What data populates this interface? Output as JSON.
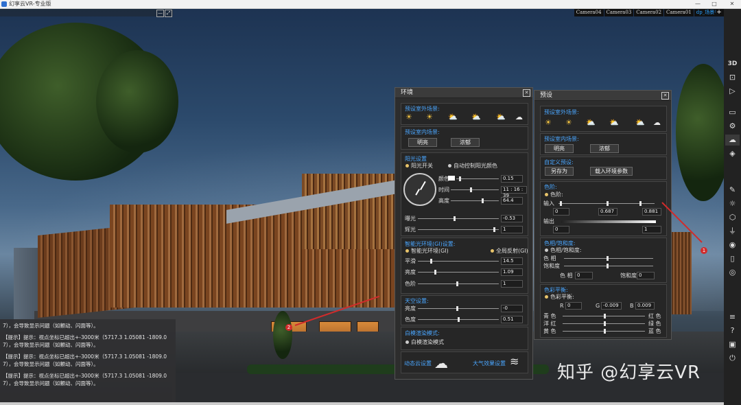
{
  "app": {
    "title": "幻享云VR-专业版",
    "window_controls": [
      "—",
      "□",
      "✕"
    ]
  },
  "cameras": {
    "tabs": [
      "Camera04",
      "Camera03",
      "Camera02",
      "Camera01",
      "dp_场景号?"
    ],
    "plus": "+"
  },
  "topleft": {
    "min": "—",
    "popout": "⤢"
  },
  "toolbar": {
    "items": [
      {
        "name": "3d",
        "label": "3D"
      },
      {
        "name": "vr",
        "label": "⊡"
      },
      {
        "name": "play",
        "label": "▷"
      },
      {
        "name": "folder",
        "label": "▭"
      },
      {
        "name": "settings",
        "label": "⚙"
      },
      {
        "name": "weather",
        "label": "☁"
      },
      {
        "name": "layers",
        "label": "◈"
      },
      {
        "name": "edit",
        "label": "✎"
      },
      {
        "name": "light",
        "label": "☼"
      },
      {
        "name": "box",
        "label": "⬡"
      },
      {
        "name": "lamp",
        "label": "⏚"
      },
      {
        "name": "camera",
        "label": "◉"
      },
      {
        "name": "phone",
        "label": "▯"
      },
      {
        "name": "screenshot",
        "label": "◎"
      },
      {
        "name": "list",
        "label": "≡"
      },
      {
        "name": "help",
        "label": "?"
      },
      {
        "name": "save",
        "label": "▣"
      },
      {
        "name": "power",
        "label": "⏻"
      }
    ]
  },
  "console": {
    "lines": [
      "7），会导致显示问题（如颤动、闪面等）。",
      "【提示】提示：视点坐标已超出+-3000米（5717.3 1.05081 -1809.0",
      "7），会导致显示问题（如颤动、闪面等）。",
      "【提示】提示：视点坐标已超出+-3000米（5717.3 1.05081 -1809.0",
      "7），会导致显示问题（如颤动、闪面等）。",
      "【提示】提示：视点坐标已超出+-3000米（5717.3 1.05081 -1809.0",
      "7），会导致显示问题（如颤动、闪面等）。"
    ]
  },
  "env": {
    "title": "环境",
    "close": "✕",
    "outdoor_title": "预设室外场景:",
    "indoor_title": "预设室内场景:",
    "bright": "明亮",
    "dense": "浓郁",
    "sun_title": "阳光设置",
    "sun_switch": "阳光开关",
    "auto_sun": "自动控制阳光颜色",
    "color_lbl": "颜色",
    "color_val": "0.15",
    "time_lbl": "时间",
    "time_val": "11 : 16 : 39",
    "height_lbl": "高度",
    "height_val": "64.4",
    "exposure_lbl": "曝光",
    "exposure_val": "-0.53",
    "shine_lbl": "辉光",
    "shine_val": "1",
    "gi_title": "智能光环境(GI)设置:",
    "gi_smart": "智能光环境(GI)",
    "gi_global": "全局反射(GI)",
    "smooth_lbl": "平滑",
    "smooth_val": "14.5",
    "brightness_lbl": "亮度",
    "brightness_val": "1.09",
    "tone_lbl": "色阶",
    "tone_val": "1",
    "sky_title": "天空设置:",
    "sky_bright_lbl": "亮度",
    "sky_bright_val": "-0",
    "sky_color_lbl": "色度",
    "sky_color_val": "0.51",
    "white_title": "白模渲染模式:",
    "white_mode": "白模渲染模式",
    "dyncloud": "动态云设置",
    "atmos": "大气效果设置"
  },
  "preset": {
    "title": "预设",
    "close": "✕",
    "outdoor_title": "预设室外场景:",
    "indoor_title": "预设室内场景:",
    "bright": "明亮",
    "dense": "浓郁",
    "custom_title": "自定义预设:",
    "save_as": "另存为",
    "load": "载入环境参数",
    "levels_title": "色阶:",
    "levels_radio": "色阶:",
    "input_lbl": "输入",
    "in_a": "0",
    "in_b": "0.687",
    "in_c": "0.881",
    "output_lbl": "输出",
    "out_a": "0",
    "out_b": "1",
    "hs_title": "色相/饱和度:",
    "hs_radio": "色相/饱和度:",
    "hue_lbl": "色    相",
    "sat_lbl": "饱和度",
    "hue2": "色    相",
    "hue2_val": "0",
    "sat2": "饱和度",
    "sat2_val": "0",
    "cb_title": "色彩平衡:",
    "cb_radio": "色彩平衡:",
    "r": "R",
    "r_val": "0",
    "g": "G",
    "g_val": "-0.009",
    "b": "B",
    "b_val": "0.009",
    "cyan": "青 色",
    "red": "红 色",
    "magenta": "洋 红",
    "green": "绿 色",
    "yellow": "黄 色",
    "blue": "蓝 色"
  },
  "annotations": {
    "one": "1",
    "two": "2"
  },
  "watermark": "知乎 @幻享云VR",
  "colors": {
    "accent": "#4aa6ff",
    "arrow": "#d12b2b",
    "sun_radio": "#e8c46a"
  }
}
